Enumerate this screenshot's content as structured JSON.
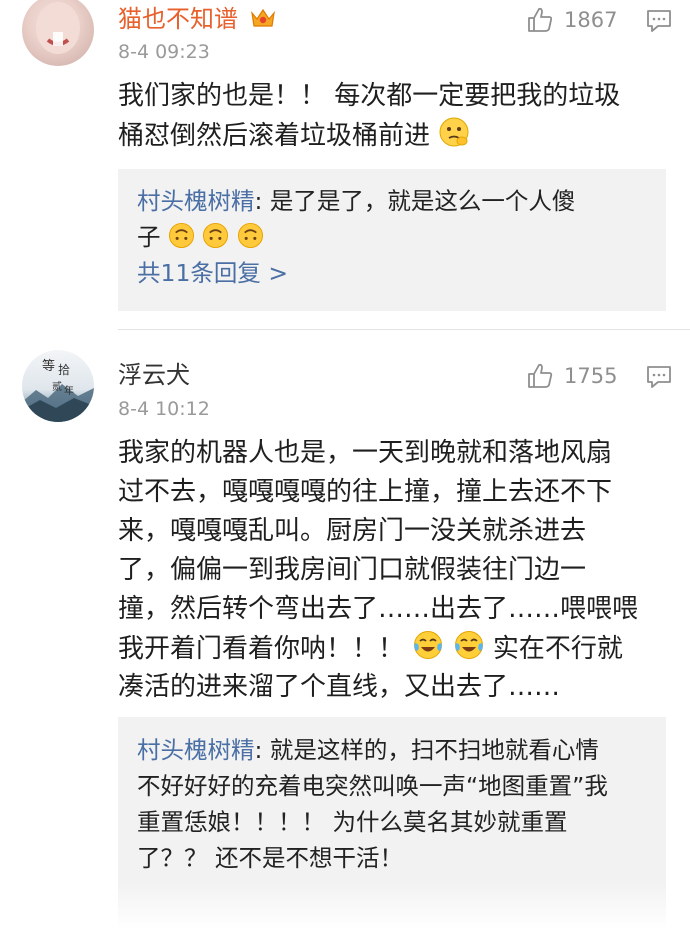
{
  "comments": [
    {
      "username": "猫也不知谱",
      "time": "8-4 09:23",
      "likes": "1867",
      "body_lines": [
        "我们家的也是！！ 每次都一定要把我的垃圾",
        "桶怼倒然后滚着垃圾桶前进"
      ],
      "body_emoji": "thinking-face-emoji",
      "reply": {
        "author": "村头槐树精",
        "sep": ": ",
        "text_line1": "是了是了，就是这么一个人傻",
        "text_line2": "子",
        "emojis": [
          "upside-down-face-emoji",
          "upside-down-face-emoji",
          "upside-down-face-emoji"
        ],
        "more_label": "共11条回复 >"
      }
    },
    {
      "username": "浮云犬",
      "time": "8-4 10:12",
      "likes": "1755",
      "avatar_text": [
        "等",
        "拾",
        "贰",
        "年"
      ],
      "body_lines": [
        "我家的机器人也是，一天到晚就和落地风扇",
        "过不去，嘎嘎嘎嘎的往上撞，撞上去还不下",
        "来，嘎嘎嘎乱叫。厨房门一没关就杀进去",
        "了，偏偏一到我房间门口就假装往门边一",
        "撞，然后转个弯出去了……出去了……喂喂喂",
        "我开着门看着你呐！！！",
        "实在不行就",
        "凑活的进来溜了个直线，又出去了……"
      ],
      "body_emojis": [
        "tears-of-joy-emoji",
        "tears-of-joy-emoji"
      ],
      "reply": {
        "author": "村头槐树精",
        "sep": ": ",
        "lines": [
          "就是这样的，扫不扫地就看心情",
          "不好好好的充着电突然叫唤一声“地图重置”我",
          "重置恁娘！！！！ 为什么莫名其妙就重置",
          "了？？ 还不是不想干活！"
        ]
      }
    }
  ],
  "colors": {
    "vip_name": "#e8602c",
    "link_blue": "#4a6fa5",
    "quote_bg": "#f2f2f2",
    "meta_gray": "#9a9a9a"
  }
}
